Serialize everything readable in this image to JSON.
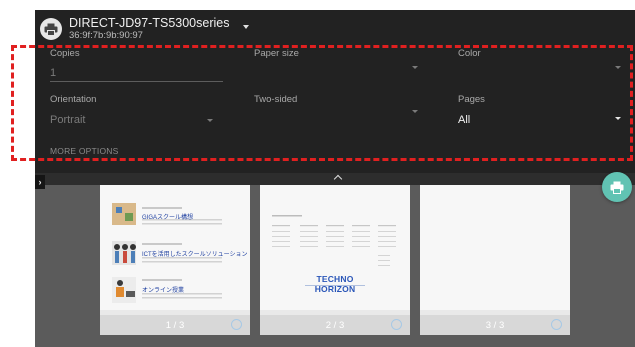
{
  "printer": {
    "name": "DIRECT-JD97-TS5300series",
    "id": "36:9f:7b:9b:90:97",
    "icon": "printer-icon"
  },
  "options": {
    "copies": {
      "label": "Copies",
      "value": "1"
    },
    "paper_size": {
      "label": "Paper size",
      "value": ""
    },
    "color": {
      "label": "Color",
      "value": ""
    },
    "orientation": {
      "label": "Orientation",
      "value": "Portrait"
    },
    "two_sided": {
      "label": "Two-sided",
      "value": ""
    },
    "pages": {
      "label": "Pages",
      "value": "All"
    },
    "more_options": "MORE OPTIONS"
  },
  "pages": [
    {
      "number": "1 / 3",
      "lines": [
        "GIGAスクール構想",
        "ICTを活用したスクールソリューション",
        "オンライン授業"
      ]
    },
    {
      "number": "2 / 3",
      "logo": "TECHNO HORIZON"
    },
    {
      "number": "3 / 3"
    }
  ],
  "fab": {
    "icon": "print-icon"
  },
  "colors": {
    "panel": "#222222",
    "preview_bg": "#5b5b5b",
    "fab": "#61c3b3",
    "highlight": "#e02020"
  }
}
